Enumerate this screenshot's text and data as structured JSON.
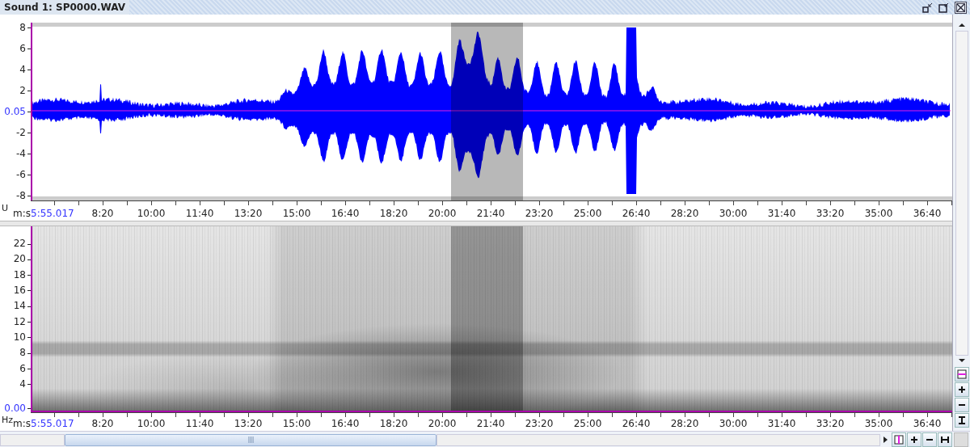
{
  "window": {
    "title": "Sound 1: SP0000.WAV"
  },
  "waveform": {
    "y_labels": [
      {
        "text": "8",
        "current": false
      },
      {
        "text": "6",
        "current": false
      },
      {
        "text": "4",
        "current": false
      },
      {
        "text": "2",
        "current": false
      },
      {
        "text": "0.05",
        "current": true
      },
      {
        "text": "-2",
        "current": false
      },
      {
        "text": "-4",
        "current": false
      },
      {
        "text": "-6",
        "current": false
      },
      {
        "text": "-8",
        "current": false
      }
    ],
    "unit": "U",
    "time_axis": {
      "unit": "m:s",
      "start": "5:55.017",
      "ticks": [
        "8:20",
        "10:00",
        "11:40",
        "13:20",
        "15:00",
        "16:40",
        "18:20",
        "20:00",
        "21:40",
        "23:20",
        "25:00",
        "26:40",
        "28:20",
        "30:00",
        "31:40",
        "33:20",
        "35:00",
        "36:40"
      ]
    }
  },
  "spectrogram": {
    "y_labels": [
      {
        "text": "22",
        "current": false
      },
      {
        "text": "20",
        "current": false
      },
      {
        "text": "18",
        "current": false
      },
      {
        "text": "16",
        "current": false
      },
      {
        "text": "14",
        "current": false
      },
      {
        "text": "12",
        "current": false
      },
      {
        "text": "10",
        "current": false
      },
      {
        "text": "8",
        "current": false
      },
      {
        "text": "6",
        "current": false
      },
      {
        "text": "4",
        "current": false
      },
      {
        "text": "0.00",
        "current": true
      }
    ],
    "unit": "Hz",
    "time_axis": {
      "unit": "m:s",
      "start": "5:55.017",
      "ticks": [
        "8:20",
        "10:00",
        "11:40",
        "13:20",
        "15:00",
        "16:40",
        "18:20",
        "20:00",
        "21:40",
        "23:20",
        "25:00",
        "26:40",
        "28:20",
        "30:00",
        "31:40",
        "33:20",
        "35:00",
        "36:40"
      ]
    }
  }
}
